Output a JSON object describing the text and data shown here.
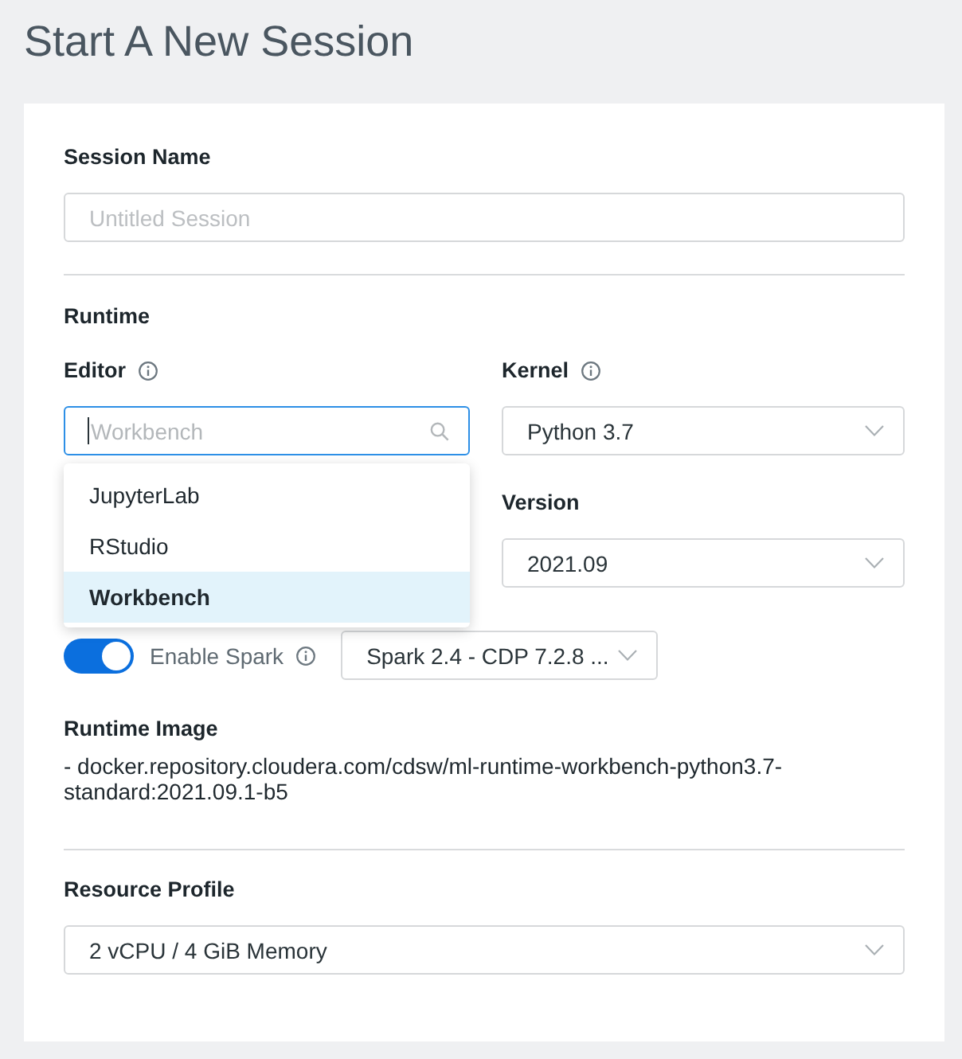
{
  "page": {
    "title": "Start A New Session"
  },
  "session_name": {
    "label": "Session Name",
    "placeholder": "Untitled Session"
  },
  "runtime": {
    "heading": "Runtime",
    "editor": {
      "label": "Editor",
      "placeholder": "Workbench",
      "expanded": true,
      "options": [
        {
          "label": "JupyterLab",
          "selected": false
        },
        {
          "label": "RStudio",
          "selected": false
        },
        {
          "label": "Workbench",
          "selected": true
        }
      ]
    },
    "kernel": {
      "label": "Kernel",
      "value": "Python 3.7"
    },
    "version": {
      "label": "Version",
      "value": "2021.09"
    },
    "spark": {
      "label": "Enable Spark",
      "on": true,
      "value": "Spark 2.4 - CDP 7.2.8 ..."
    },
    "image": {
      "label": "Runtime Image",
      "value": "- docker.repository.cloudera.com/cdsw/ml-runtime-workbench-python3.7-standard:2021.09.1-b5"
    }
  },
  "resource_profile": {
    "label": "Resource Profile",
    "value": "2 vCPU / 4 GiB Memory"
  }
}
